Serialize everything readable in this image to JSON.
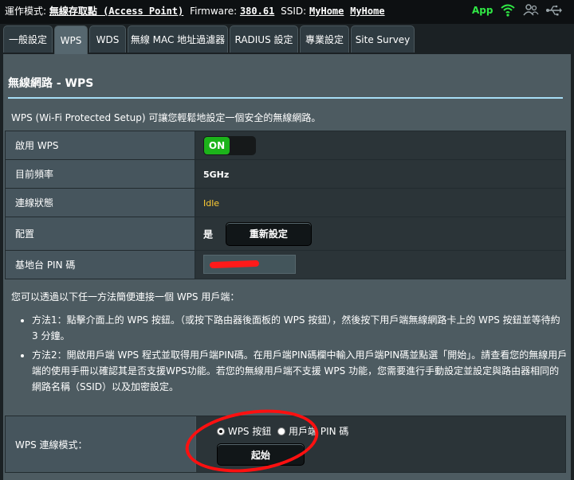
{
  "topbar": {
    "mode_label": "運作模式:",
    "mode_value": "無線存取點 (Access Point)",
    "firmware_label": "Firmware:",
    "firmware_value": "380.61",
    "ssid_label": "SSID:",
    "ssid_1": "MyHome",
    "ssid_2": "MyHome",
    "app_label": "App",
    "icons": [
      "wifi-icon",
      "users-icon",
      "usb-icon"
    ]
  },
  "tabs": [
    {
      "label": "一般設定",
      "active": false
    },
    {
      "label": "WPS",
      "active": true
    },
    {
      "label": "WDS",
      "active": false
    },
    {
      "label": "無線 MAC 地址過濾器",
      "active": false
    },
    {
      "label": "RADIUS 設定",
      "active": false
    },
    {
      "label": "專業設定",
      "active": false
    },
    {
      "label": "Site Survey",
      "active": false
    }
  ],
  "page": {
    "title_prefix": "無線網路",
    "title_suffix": " - WPS",
    "description": "WPS (Wi-Fi Protected Setup) 可讓您輕鬆地設定一個安全的無線網路。"
  },
  "form": {
    "enable_wps_label": "啟用 WPS",
    "enable_wps_state": "ON",
    "frequency_label": "目前頻率",
    "frequency_value": "5GHz",
    "status_label": "連線狀態",
    "status_value": "Idle",
    "config_label": "配置",
    "config_value": "是",
    "reset_button": "重新設定",
    "pin_label": "基地台 PIN 碼"
  },
  "methods": {
    "intro": "您可以透過以下任一方法簡便連接一個 WPS 用戶端：",
    "items": [
      "方法1：點擊介面上的 WPS 按鈕。（或按下路由器後面板的 WPS 按鈕），然後按下用戶端無線網路卡上的 WPS 按鈕並等待約 3 分鐘。",
      "方法2：開啟用戶端 WPS 程式並取得用戶端PIN碼。在用戶端PIN碼欄中輸入用戶端PIN碼並點選「開始」。請查看您的無線用戶端的使用手冊以確認其是否支援WPS功能。若您的無線用戶端不支援 WPS 功能，您需要進行手動設定並設定與路由器相同的網路名稱（SSID）以及加密設定。"
    ]
  },
  "mode": {
    "label": "WPS 連線模式：",
    "option_1": "WPS 按鈕",
    "option_2": "用戶端 PIN 碼",
    "selected": 1,
    "start_button": "起始"
  },
  "colors": {
    "accent_green": "#1cb31a",
    "app_green": "#30e845",
    "idle_yellow": "#ffcc33",
    "title_rule": "#a6ddf5",
    "annotation_red": "#ff1010"
  }
}
